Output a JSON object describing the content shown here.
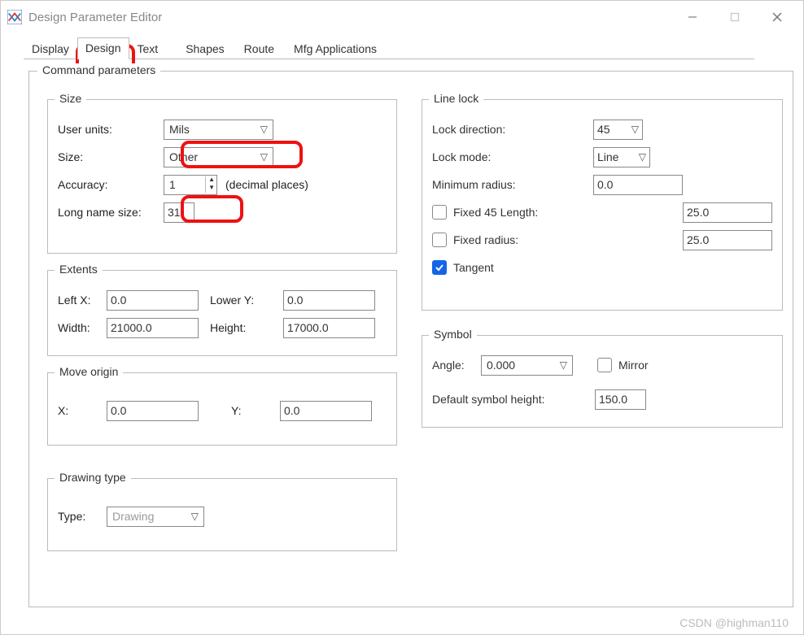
{
  "window": {
    "title": "Design Parameter Editor"
  },
  "tabs": {
    "display": "Display",
    "design": "Design",
    "text": "Text",
    "shapes": "Shapes",
    "route": "Route",
    "mfg": "Mfg Applications"
  },
  "main_group": "Command parameters",
  "size": {
    "group": "Size",
    "user_units_label": "User units:",
    "user_units_value": "Mils",
    "size_label": "Size:",
    "size_value": "Other",
    "accuracy_label": "Accuracy:",
    "accuracy_value": "1",
    "accuracy_hint": "(decimal places)",
    "long_name_label": "Long name size:",
    "long_name_value": "31"
  },
  "extents": {
    "group": "Extents",
    "leftx_label": "Left X:",
    "leftx_value": "0.0",
    "lowery_label": "Lower Y:",
    "lowery_value": "0.0",
    "width_label": "Width:",
    "width_value": "21000.0",
    "height_label": "Height:",
    "height_value": "17000.0"
  },
  "move": {
    "group": "Move origin",
    "x_label": "X:",
    "x_value": "0.0",
    "y_label": "Y:",
    "y_value": "0.0"
  },
  "drawing": {
    "group": "Drawing type",
    "type_label": "Type:",
    "type_value": "Drawing"
  },
  "linelock": {
    "group": "Line lock",
    "lock_dir_label": "Lock direction:",
    "lock_dir_value": "45",
    "lock_mode_label": "Lock mode:",
    "lock_mode_value": "Line",
    "min_radius_label": "Minimum radius:",
    "min_radius_value": "0.0",
    "fixed45_label": "Fixed 45 Length:",
    "fixed45_value": "25.0",
    "fixed_radius_label": "Fixed radius:",
    "fixed_radius_value": "25.0",
    "tangent_label": "Tangent"
  },
  "symbol": {
    "group": "Symbol",
    "angle_label": "Angle:",
    "angle_value": "0.000",
    "mirror_label": "Mirror",
    "default_height_label": "Default symbol height:",
    "default_height_value": "150.0"
  },
  "watermark": "CSDN @highman110"
}
